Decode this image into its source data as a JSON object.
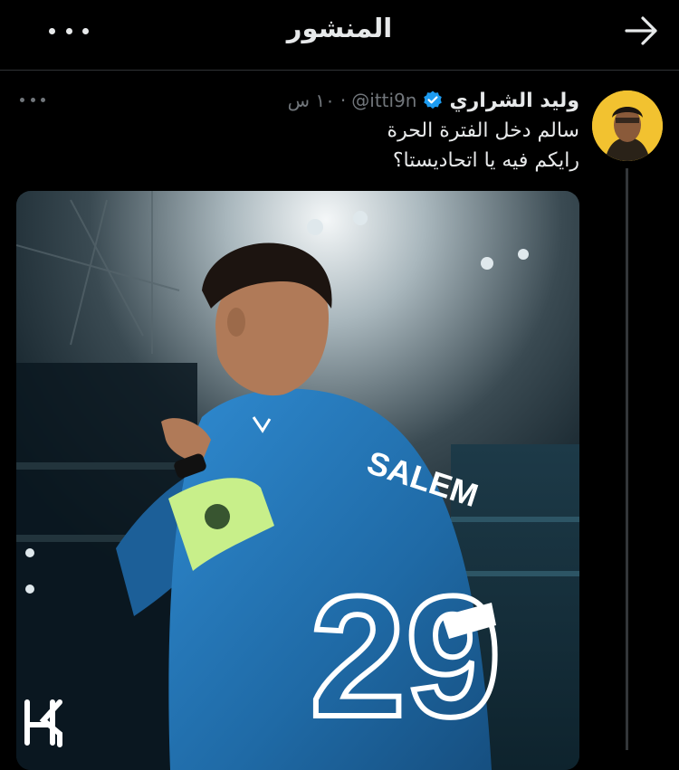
{
  "header": {
    "title": "المنشور",
    "back_icon": "arrow-right-icon",
    "more_icon": "more-horizontal-icon"
  },
  "post": {
    "author_name": "وليد الشراري",
    "verified_icon": "verified-badge-icon",
    "handle": "@itti9n",
    "separator": "·",
    "time": "١٠ س",
    "text_lines": [
      "سالم دخل الفترة الحرة",
      "رايكم فيه يا اتحاديستا؟"
    ],
    "media": {
      "jersey_name": "SALEM",
      "jersey_number": "29"
    }
  },
  "colors": {
    "background": "#000000",
    "text_primary": "#e7e9ea",
    "text_secondary": "#71767b",
    "verified_blue": "#1d9bf0",
    "jersey_blue": "#1f74b8",
    "armband_green": "#c8ef8a",
    "avatar_bg": "#f2c230"
  }
}
